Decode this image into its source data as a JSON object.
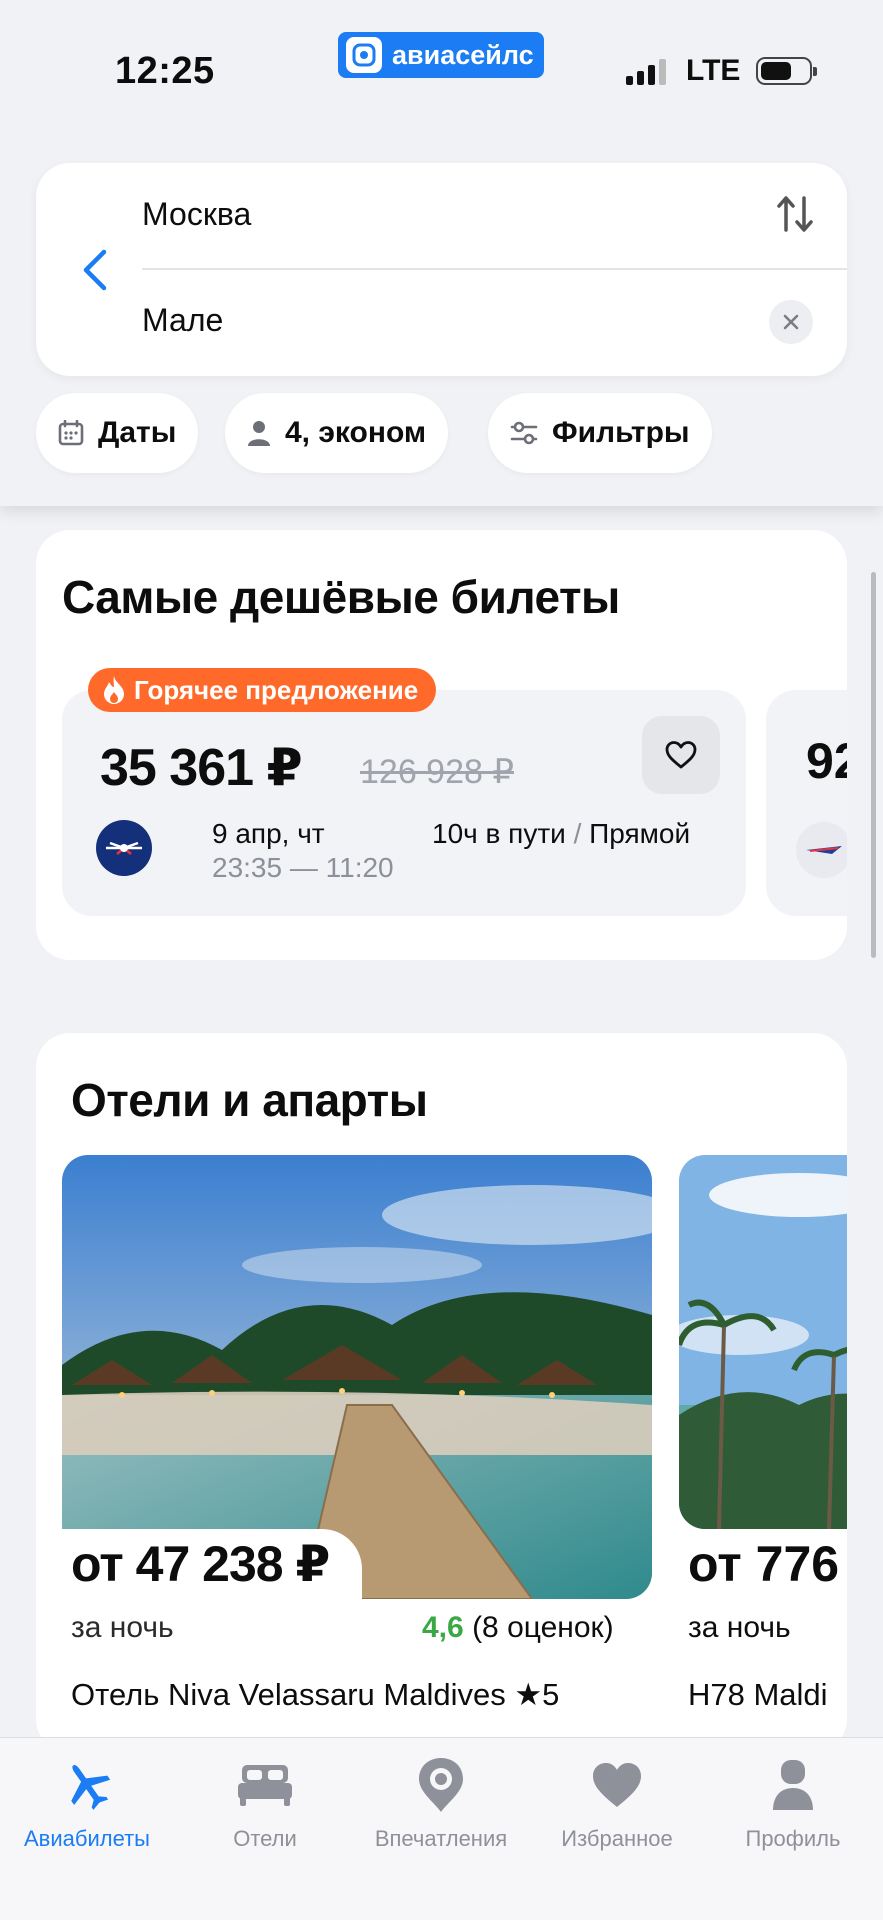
{
  "status_bar": {
    "time": "12:25",
    "app_pill_label": "авиасейлс",
    "network": "LTE",
    "battery_level": 0.65
  },
  "search": {
    "origin": "Москва",
    "destination": "Мале"
  },
  "filters": {
    "dates_label": "Даты",
    "passengers_label": "4, эконом",
    "filters_label": "Фильтры"
  },
  "cheapest": {
    "title": "Самые дешёвые билеты",
    "badge": "Горячее предложение",
    "ticket": {
      "price": "35 361 ₽",
      "old_price": "126 928 ₽",
      "date": "9 апр, чт",
      "times": "23:35 — 11:20",
      "duration": "10ч в пути",
      "separator": "/",
      "stops": "Прямой"
    },
    "next_ticket_partial_price": "92"
  },
  "hotels": {
    "title": "Отели и апарты",
    "items": [
      {
        "price": "от 47 238 ₽",
        "per_night": "за ночь",
        "rating_score": "4,6",
        "rating_count": "(8 оценок)",
        "name": "Отель Niva Velassaru Maldives ★5"
      },
      {
        "price": "от 776",
        "per_night": "за ночь",
        "name": "H78 Maldi"
      }
    ]
  },
  "bottom_nav": {
    "items": [
      {
        "label": "Авиабилеты",
        "icon": "airplane-icon",
        "active": true
      },
      {
        "label": "Отели",
        "icon": "bed-icon",
        "active": false
      },
      {
        "label": "Впечатления",
        "icon": "camera-pin-icon",
        "active": false
      },
      {
        "label": "Избранное",
        "icon": "heart-icon",
        "active": false
      },
      {
        "label": "Профиль",
        "icon": "person-icon",
        "active": false
      }
    ]
  },
  "colors": {
    "accent": "#1b7cf4",
    "hot_badge": "#ff6a2b",
    "rating_green": "#3aa845",
    "background": "#f1f2f6"
  }
}
